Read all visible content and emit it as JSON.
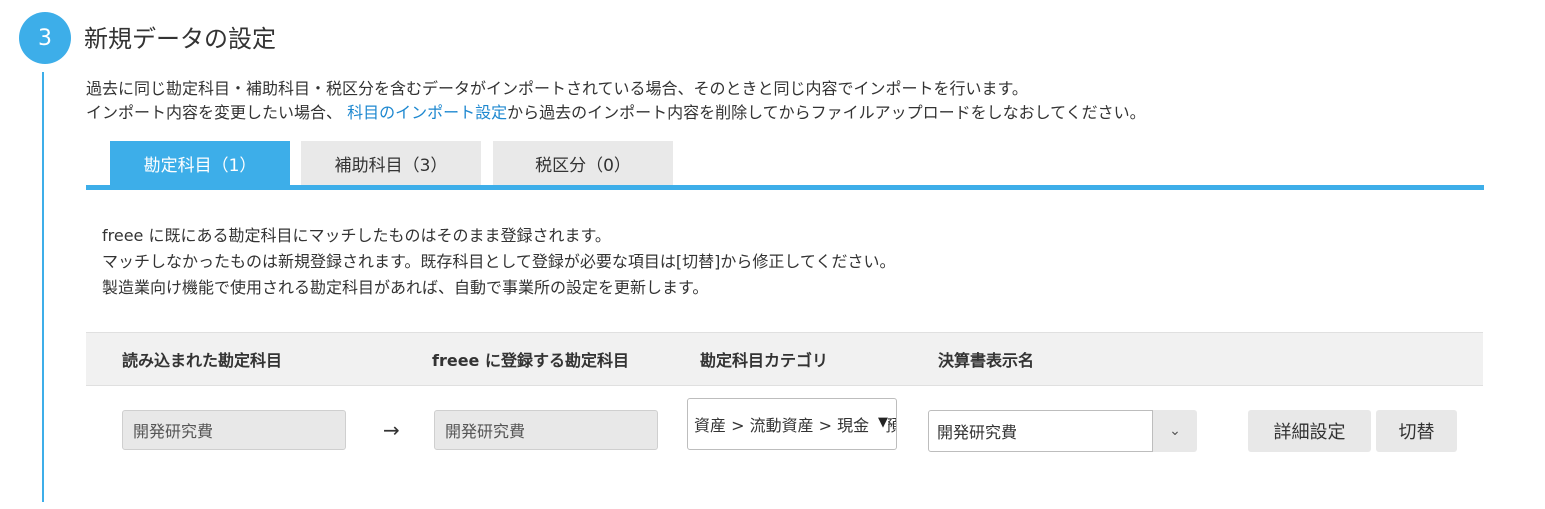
{
  "step": {
    "number": "3",
    "title": "新規データの設定"
  },
  "description": {
    "line1": "過去に同じ勘定科目・補助科目・税区分を含むデータがインポートされている場合、そのときと同じ内容でインポートを行います。",
    "line2_prefix": "インポート内容を変更したい場合、",
    "line2_link": "科目のインポート設定",
    "line2_suffix": "から過去のインポート内容を削除してからファイルアップロードをしなおしてください。"
  },
  "tabs": [
    {
      "label": "勘定科目（1）",
      "active": true
    },
    {
      "label": "補助科目（3）",
      "active": false
    },
    {
      "label": "税区分（0）",
      "active": false
    }
  ],
  "info": {
    "line1": "freee に既にある勘定科目にマッチしたものはそのまま登録されます。",
    "line2": "マッチしなかったものは新規登録されます。既存科目として登録が必要な項目は[切替]から修正してください。",
    "line3": "製造業向け機能で使用される勘定科目があれば、自動で事業所の設定を更新します。"
  },
  "table": {
    "headers": [
      "読み込まれた勘定科目",
      "freee に登録する勘定科目",
      "勘定科目カテゴリ",
      "決算書表示名"
    ],
    "row": {
      "imported_account": "開発研究費",
      "arrow": "→",
      "freee_account": "開発研究費",
      "category": "資産 > 流動資産 > 現金・預金",
      "category_caret": "▼",
      "display_name": "開発研究費",
      "combo_caret": "⌄",
      "detail_button": "詳細設定",
      "switch_button": "切替"
    }
  },
  "colors": {
    "accent": "#3daee9",
    "link": "#1e88d0",
    "button_bg": "#e8e8e8"
  }
}
